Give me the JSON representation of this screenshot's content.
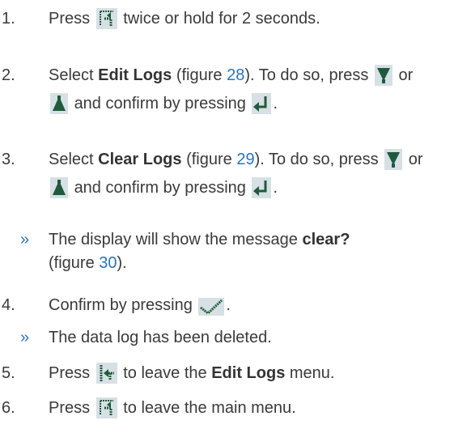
{
  "steps": [
    {
      "number": "1.",
      "text_a": "Press",
      "text_b": "twice or hold for 2 seconds."
    },
    {
      "number": "2.",
      "text_a": "Select ",
      "bold": "Edit Logs",
      "text_b": " (figure ",
      "figure_ref": "28",
      "text_c": "). To do so, press",
      "text_d": "or",
      "text_e": "and confirm by pressing",
      "text_f": "."
    },
    {
      "number": "3.",
      "text_a": "Select ",
      "bold": "Clear Logs",
      "text_b": " (figure ",
      "figure_ref": "29",
      "text_c": "). To do so, press",
      "text_d": "or",
      "text_e": "and confirm by pressing",
      "text_f": "."
    },
    {
      "number": "4.",
      "text_a": "Confirm by pressing",
      "text_b": "."
    },
    {
      "number": "5.",
      "text_a": "Press",
      "text_b": "to leave the ",
      "bold": "Edit Logs",
      "text_c": " menu."
    },
    {
      "number": "6.",
      "text_a": "Press",
      "text_b": "to leave the main menu."
    }
  ],
  "results": [
    {
      "bullet": "»",
      "text_a": "The display will show the message ",
      "bold": "clear?",
      "text_b": "(figure ",
      "figure_ref": "30",
      "text_c": ")."
    },
    {
      "bullet": "»",
      "text_a": "The data log has been deleted."
    }
  ],
  "icons": {
    "menu": "menu-enter-icon",
    "down": "down-arrow-icon",
    "up": "up-arrow-icon",
    "enter": "enter-key-icon",
    "confirm": "checkmark-icon",
    "back": "back-icon"
  },
  "colors": {
    "text": "#3a3a3a",
    "link": "#2c74b8",
    "icon_bg": "#d7e0e4",
    "icon_fg": "#1f5a3c"
  }
}
